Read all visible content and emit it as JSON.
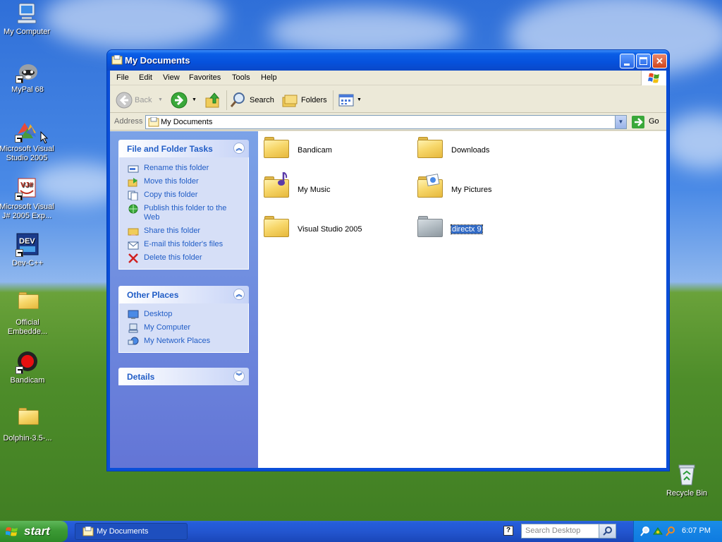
{
  "desktop": {
    "icons": [
      {
        "label": "My Computer"
      },
      {
        "label": "MyPal 68"
      },
      {
        "label": "Microsoft Visual Studio 2005"
      },
      {
        "label": "Microsoft Visual J# 2005 Exp..."
      },
      {
        "label": "Dev-C++"
      },
      {
        "label": "Official Embedde..."
      },
      {
        "label": "Bandicam"
      },
      {
        "label": "Dolphin-3.5-..."
      },
      {
        "label": "Recycle Bin"
      }
    ]
  },
  "window": {
    "title": "My Documents",
    "menu": [
      "File",
      "Edit",
      "View",
      "Favorites",
      "Tools",
      "Help"
    ],
    "toolbar": {
      "back": "Back",
      "search": "Search",
      "folders": "Folders"
    },
    "address": {
      "label": "Address",
      "value": "My Documents",
      "go": "Go"
    },
    "side_panel": {
      "file_tasks": {
        "title": "File and Folder Tasks",
        "items": [
          "Rename this folder",
          "Move this folder",
          "Copy this folder",
          "Publish this folder to the Web",
          "Share this folder",
          "E-mail this folder's files",
          "Delete this folder"
        ]
      },
      "other_places": {
        "title": "Other Places",
        "items": [
          "Desktop",
          "My Computer",
          "My Network Places"
        ]
      },
      "details": {
        "title": "Details"
      }
    },
    "folders": [
      {
        "name": "Bandicam"
      },
      {
        "name": "Downloads"
      },
      {
        "name": "My Music"
      },
      {
        "name": "My Pictures"
      },
      {
        "name": "Visual Studio 2005"
      },
      {
        "name": "directx 9",
        "selected": true
      }
    ]
  },
  "taskbar": {
    "start_label": "start",
    "task_button": "My Documents",
    "search_placeholder": "Search Desktop",
    "clock": "6:07 PM"
  },
  "colors": {
    "taskbar_blue": "#245ddb",
    "start_green": "#3c9a35",
    "selection": "#316ac5",
    "link_blue": "#215dc6"
  }
}
